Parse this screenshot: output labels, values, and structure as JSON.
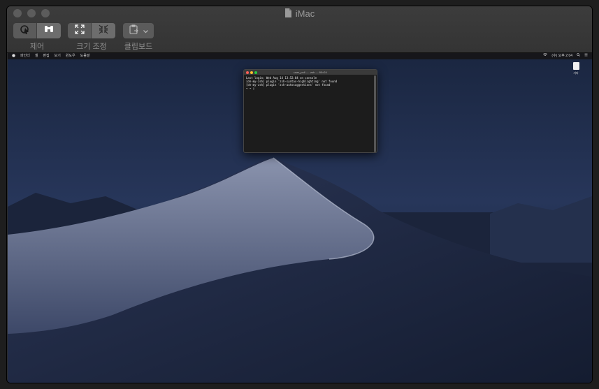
{
  "window": {
    "title": "iMac"
  },
  "toolbar": {
    "control_label": "제어",
    "resize_label": "크기 조정",
    "clipboard_label": "클립보드"
  },
  "menubar": {
    "items": [
      "파인더",
      "셀",
      "편집",
      "보기",
      "윈도우",
      "도움말"
    ],
    "status": [
      "",
      "",
      "(수) 오후 2:04"
    ]
  },
  "desktop": {
    "icon_label": "기타"
  },
  "terminal": {
    "title": "user_pull — -zsh — 80×24",
    "lines": [
      "Last login: Wed Aug 14 13:52:04 on console",
      "[oh-my-zsh] plugin 'zsh-syntax-highlighting' not found",
      "[oh-my-zsh] plugin 'zsh-autosuggestions' not found",
      "",
      "→ ~ ▯"
    ]
  },
  "colors": {
    "accent": "#ff5f57",
    "yellow": "#febc2e",
    "green": "#28c840"
  }
}
